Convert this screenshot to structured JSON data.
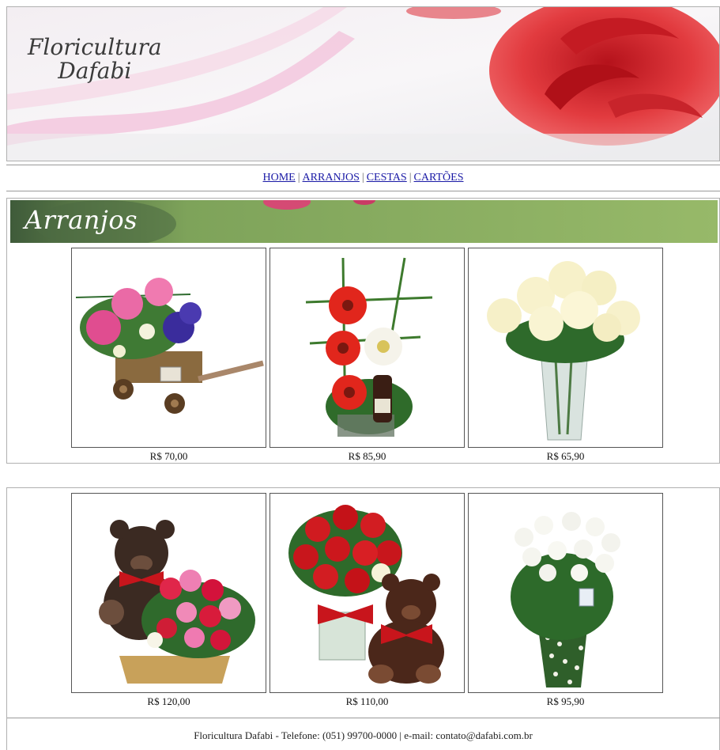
{
  "header": {
    "logo_line1": "Floricultura",
    "logo_line2": "Dafabi"
  },
  "nav": {
    "items": [
      {
        "label": "HOME"
      },
      {
        "label": "ARRANJOS"
      },
      {
        "label": "CESTAS"
      },
      {
        "label": "CARTÕES"
      }
    ],
    "separator": "|"
  },
  "section": {
    "title": "Arranjos"
  },
  "products": [
    {
      "price": "R$ 70,00",
      "icon": "flower-cart-arrangement"
    },
    {
      "price": "R$ 85,90",
      "icon": "gerbera-wine-arrangement"
    },
    {
      "price": "R$ 65,90",
      "icon": "white-roses-vase"
    },
    {
      "price": "R$ 120,00",
      "icon": "teddy-bear-basket"
    },
    {
      "price": "R$ 110,00",
      "icon": "red-roses-teddy-bear"
    },
    {
      "price": "R$ 95,90",
      "icon": "white-roses-polka-pot"
    }
  ],
  "footer": {
    "text": "Floricultura Dafabi - Telefone: (051) 99700-0000 | e-mail: contato@dafabi.com.br"
  },
  "colors": {
    "link": "#1a1aa6",
    "rose": "#d8232a",
    "banner_green": "#8fb062"
  }
}
